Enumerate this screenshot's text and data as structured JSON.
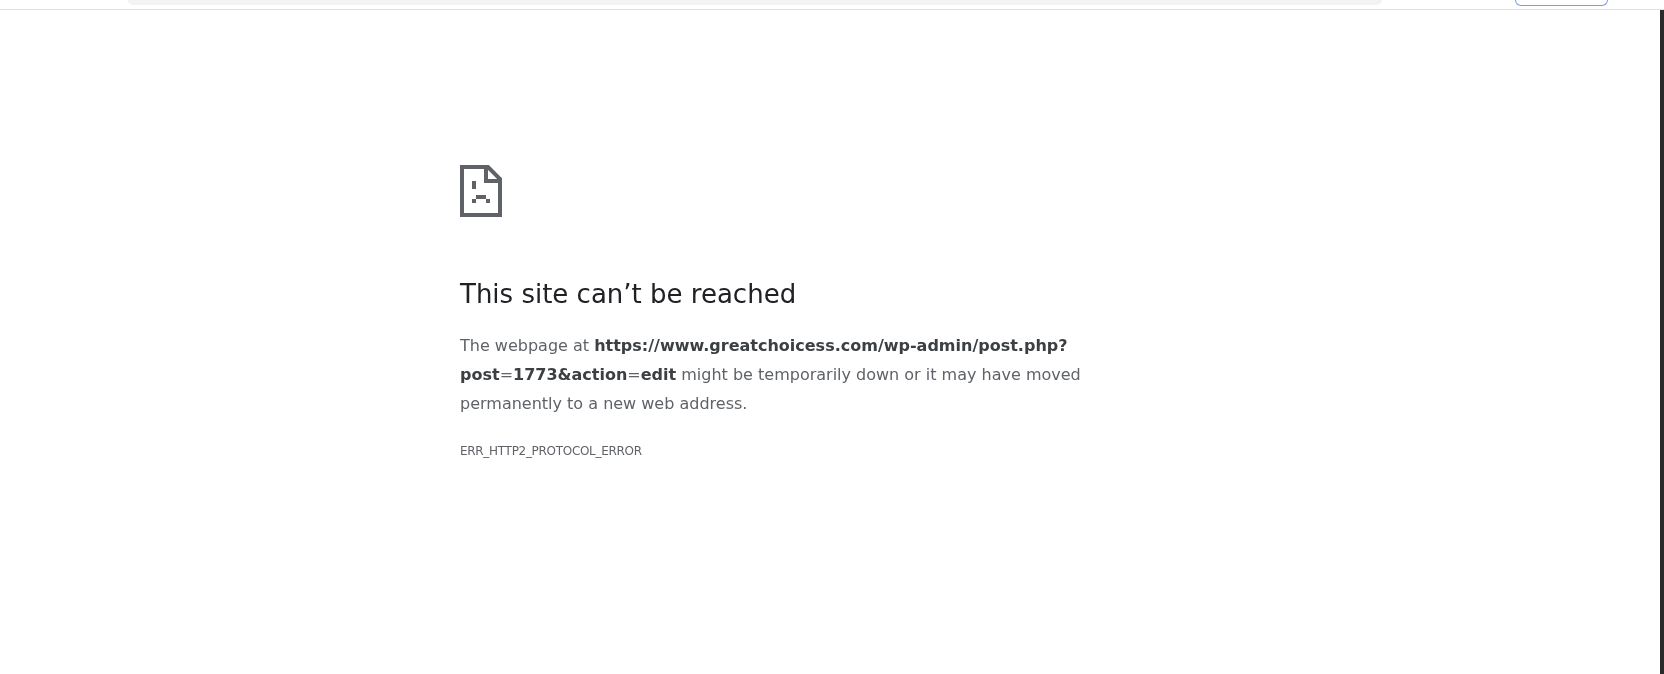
{
  "error_page": {
    "title": "This site can’t be reached",
    "message": "The webpage at **https://www.greatchoicess.com/wp-admin/post.php?post**=**1773&action**=**edit** might be temporarily down or it may have moved permanently to a new web address.",
    "error_code": "ERR_HTTP2_PROTOCOL_ERROR"
  }
}
